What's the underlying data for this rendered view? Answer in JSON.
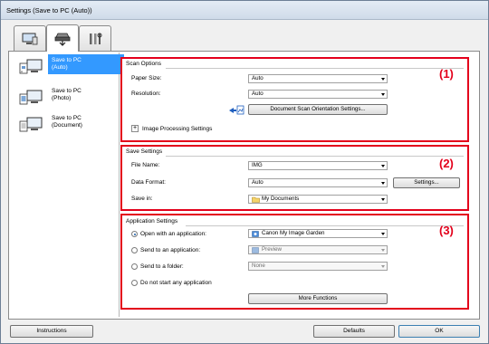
{
  "window": {
    "title": "Settings (Save to PC (Auto))"
  },
  "tabs": [
    {
      "name": "scan-from-computer",
      "icon": "computer-icon"
    },
    {
      "name": "scan-from-operation-panel",
      "icon": "scanner-icon"
    },
    {
      "name": "general-settings",
      "icon": "tools-icon"
    }
  ],
  "sidebar": {
    "items": [
      {
        "label_line1": "Save to PC",
        "label_line2": "(Auto)",
        "icon": "scan-auto-icon",
        "selected": true
      },
      {
        "label_line1": "Save to PC",
        "label_line2": "(Photo)",
        "icon": "scan-photo-icon",
        "selected": false
      },
      {
        "label_line1": "Save to PC",
        "label_line2": "(Document)",
        "icon": "scan-document-icon",
        "selected": false
      }
    ]
  },
  "scan_options": {
    "title": "Scan Options",
    "number": "(1)",
    "paper_size_label": "Paper Size:",
    "paper_size_value": "Auto",
    "resolution_label": "Resolution:",
    "resolution_value": "Auto",
    "orientation_button": "Document Scan Orientation Settings...",
    "image_processing_label": "Image Processing Settings",
    "expand_symbol": "+"
  },
  "save_settings": {
    "title": "Save Settings",
    "number": "(2)",
    "file_name_label": "File Name:",
    "file_name_value": "IMG",
    "data_format_label": "Data Format:",
    "data_format_value": "Auto",
    "settings_button": "Settings...",
    "save_in_label": "Save in:",
    "save_in_value": "My Documents"
  },
  "app_settings": {
    "title": "Application Settings",
    "number": "(3)",
    "open_app_label": "Open with an application:",
    "open_app_value": "Canon My Image Garden",
    "send_app_label": "Send to an application:",
    "send_app_value": "Preview",
    "send_folder_label": "Send to a folder:",
    "send_folder_value": "None",
    "no_app_label": "Do not start any application",
    "more_functions_button": "More Functions",
    "selected_option": "open_app"
  },
  "footer": {
    "instructions_button": "Instructions",
    "defaults_button": "Defaults",
    "ok_button": "OK"
  },
  "colors": {
    "highlight_red": "#e3001b",
    "selection_blue": "#3399ff"
  }
}
